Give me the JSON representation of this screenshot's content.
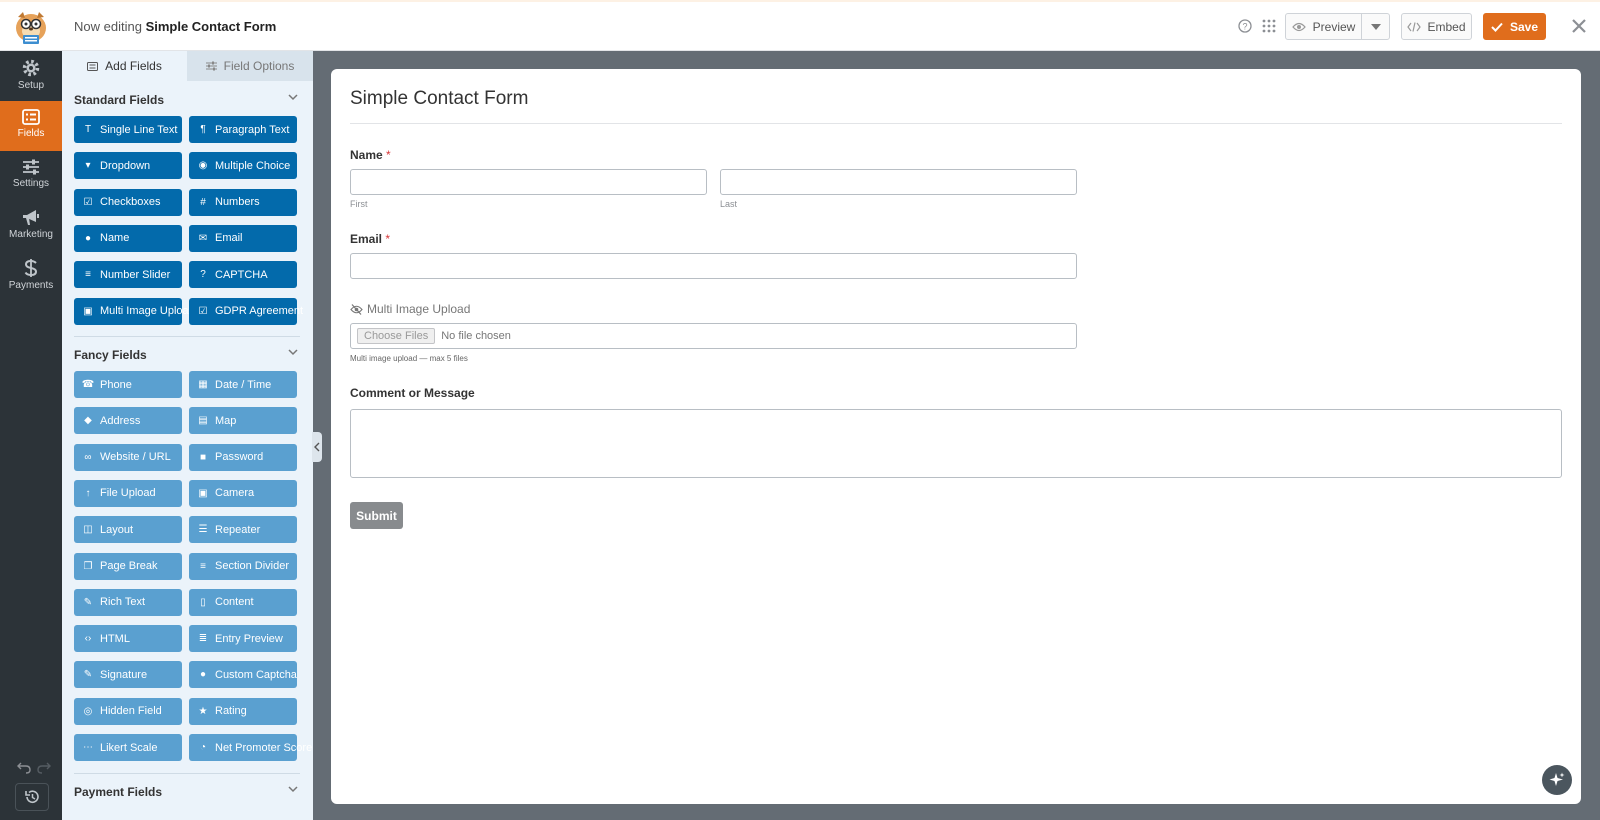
{
  "header": {
    "editing_prefix": "Now editing",
    "form_name": "Simple Contact Form",
    "preview_label": "Preview",
    "embed_label": "Embed",
    "save_label": "Save"
  },
  "nav": {
    "items": [
      {
        "label": "Setup",
        "icon": "gear-icon"
      },
      {
        "label": "Fields",
        "icon": "fields-icon"
      },
      {
        "label": "Settings",
        "icon": "sliders-icon"
      },
      {
        "label": "Marketing",
        "icon": "megaphone-icon"
      },
      {
        "label": "Payments",
        "icon": "dollar-icon"
      }
    ],
    "active": "Fields"
  },
  "panel": {
    "tabs": [
      {
        "label": "Add Fields"
      },
      {
        "label": "Field Options"
      }
    ],
    "standard_title": "Standard Fields",
    "standard_fields": [
      {
        "label": "Single Line Text",
        "icon": "text-icon"
      },
      {
        "label": "Paragraph Text",
        "icon": "paragraph-icon"
      },
      {
        "label": "Dropdown",
        "icon": "dropdown-icon"
      },
      {
        "label": "Multiple Choice",
        "icon": "radio-icon"
      },
      {
        "label": "Checkboxes",
        "icon": "checkbox-icon"
      },
      {
        "label": "Numbers",
        "icon": "hash-icon"
      },
      {
        "label": "Name",
        "icon": "user-icon"
      },
      {
        "label": "Email",
        "icon": "envelope-icon"
      },
      {
        "label": "Number Slider",
        "icon": "slider-icon"
      },
      {
        "label": "CAPTCHA",
        "icon": "question-icon"
      },
      {
        "label": "Multi Image Upload",
        "icon": "image-icon"
      },
      {
        "label": "GDPR Agreement",
        "icon": "checkbox-icon"
      }
    ],
    "fancy_title": "Fancy Fields",
    "fancy_fields": [
      {
        "label": "Phone",
        "icon": "phone-icon"
      },
      {
        "label": "Date / Time",
        "icon": "calendar-icon"
      },
      {
        "label": "Address",
        "icon": "map-pin-icon"
      },
      {
        "label": "Map",
        "icon": "map-icon"
      },
      {
        "label": "Website / URL",
        "icon": "link-icon"
      },
      {
        "label": "Password",
        "icon": "lock-icon"
      },
      {
        "label": "File Upload",
        "icon": "upload-icon"
      },
      {
        "label": "Camera",
        "icon": "camera-icon"
      },
      {
        "label": "Layout",
        "icon": "layout-icon"
      },
      {
        "label": "Repeater",
        "icon": "list-icon"
      },
      {
        "label": "Page Break",
        "icon": "copy-icon"
      },
      {
        "label": "Section Divider",
        "icon": "divider-icon"
      },
      {
        "label": "Rich Text",
        "icon": "edit-icon"
      },
      {
        "label": "Content",
        "icon": "file-icon"
      },
      {
        "label": "HTML",
        "icon": "code-icon"
      },
      {
        "label": "Entry Preview",
        "icon": "file-text-icon"
      },
      {
        "label": "Signature",
        "icon": "pen-icon"
      },
      {
        "label": "Custom Captcha",
        "icon": "question-circle-icon"
      },
      {
        "label": "Hidden Field",
        "icon": "eye-slash-icon"
      },
      {
        "label": "Rating",
        "icon": "star-icon"
      },
      {
        "label": "Likert Scale",
        "icon": "dots-icon"
      },
      {
        "label": "Net Promoter Score",
        "icon": "gauge-icon"
      }
    ],
    "payment_title": "Payment Fields"
  },
  "form": {
    "title": "Simple Contact Form",
    "name_label": "Name",
    "required_mark": "*",
    "first_sublabel": "First",
    "last_sublabel": "Last",
    "email_label": "Email",
    "upload_label": "Multi Image Upload",
    "choose_files": "Choose Files",
    "no_file": "No file chosen",
    "upload_desc": "Multi image upload — max 5 files",
    "message_label": "Comment or Message",
    "submit_label": "Submit"
  },
  "colors": {
    "brand_orange": "#e06d1c",
    "standard_button": "#036aab",
    "fancy_button": "#5aa0d0",
    "nav_bg": "#2c3338"
  }
}
